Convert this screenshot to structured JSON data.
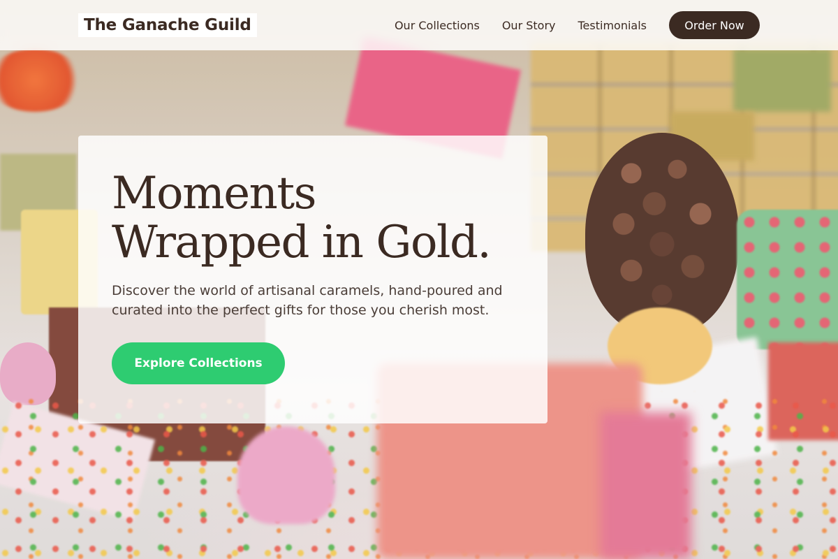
{
  "header": {
    "logo_text": "The Ganache Guild",
    "nav": [
      {
        "label": "Our Collections"
      },
      {
        "label": "Our Story"
      },
      {
        "label": "Testimonials"
      }
    ],
    "cta_label": "Order Now"
  },
  "hero": {
    "title_line1": "Moments",
    "title_line2": "Wrapped in Gold.",
    "description": "Discover the world of artisanal caramels, hand-poured and curated into the perfect gifts for those you cherish most.",
    "button_label": "Explore Collections"
  },
  "colors": {
    "brand_dark": "#3b2a22",
    "accent_green": "#2ecc71",
    "header_bg": "#ffffff"
  }
}
